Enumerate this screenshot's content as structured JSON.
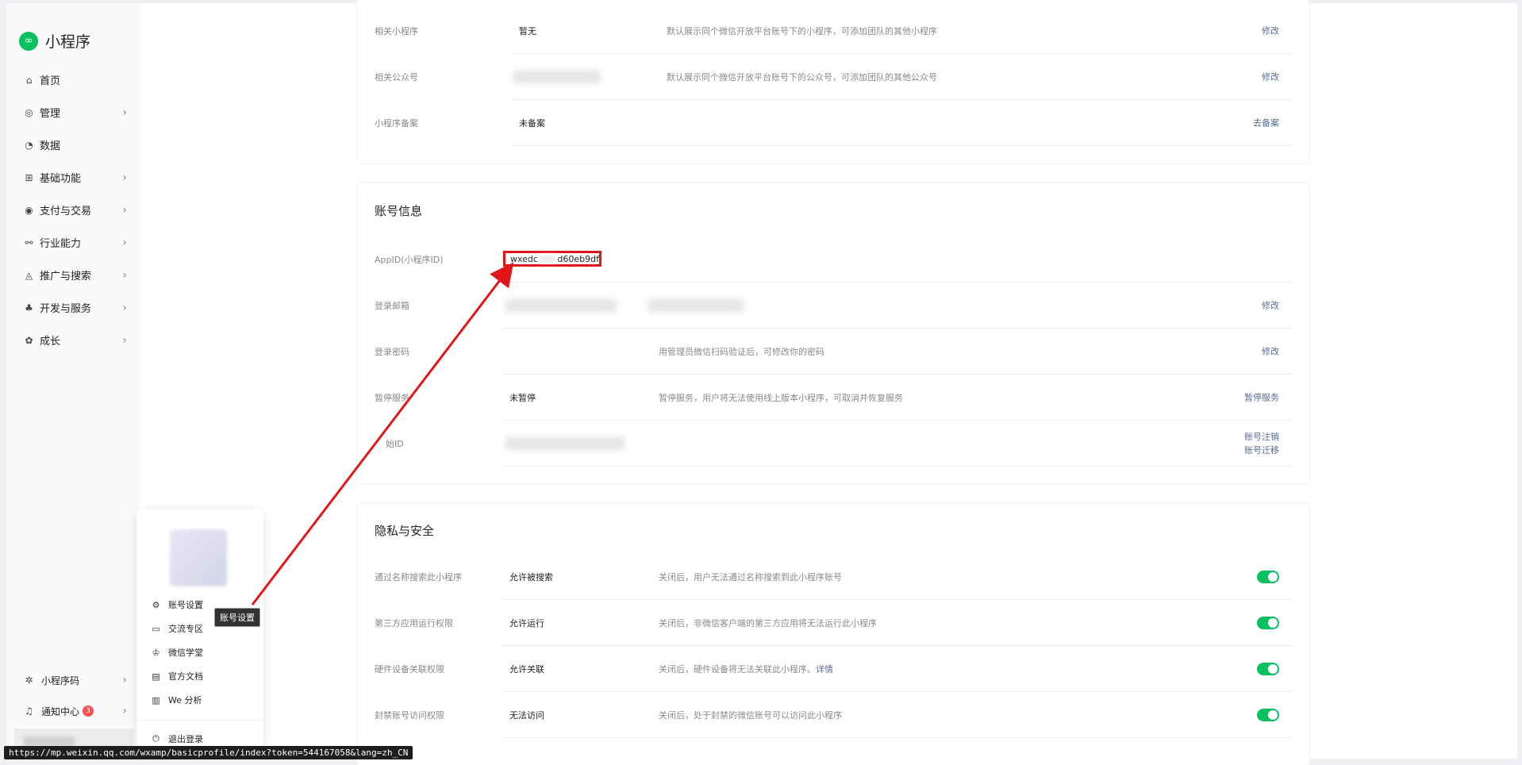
{
  "app": {
    "name": "小程序",
    "logo_icon": "miniprogram-logo-icon",
    "accent": "#07c160"
  },
  "sidebar": {
    "items": [
      {
        "label": "首页",
        "icon": "home-icon",
        "chev": false
      },
      {
        "label": "管理",
        "icon": "settings-icon",
        "chev": true
      },
      {
        "label": "数据",
        "icon": "clock-icon",
        "chev": false
      },
      {
        "label": "基础功能",
        "icon": "grid-icon",
        "chev": true
      },
      {
        "label": "支付与交易",
        "icon": "target-icon",
        "chev": true
      },
      {
        "label": "行业能力",
        "icon": "network-icon",
        "chev": true
      },
      {
        "label": "推广与搜索",
        "icon": "flame-icon",
        "chev": true
      },
      {
        "label": "开发与服务",
        "icon": "cluster-icon",
        "chev": true
      },
      {
        "label": "成长",
        "icon": "badge-icon",
        "chev": true
      }
    ],
    "bottom": {
      "qrcode": "小程序码",
      "notice": "通知中心",
      "notice_count": "3"
    }
  },
  "popup": {
    "items": [
      "账号设置",
      "交流专区",
      "微信学堂",
      "官方文档",
      "We 分析"
    ],
    "logout": "退出登录"
  },
  "tooltip": "账号设置",
  "status_url": "https://mp.weixin.qq.com/wxamp/basicprofile/index?token=544167058&lang=zh_CN",
  "section1": {
    "rows": [
      {
        "label": "相关小程序",
        "value": "暂无",
        "desc": "默认展示同个微信开放平台账号下的小程序，可添加团队的其他小程序",
        "action": "修改"
      },
      {
        "label": "相关公众号",
        "value": "",
        "desc": "默认展示同个微信开放平台账号下的公众号，可添加团队的其他公众号",
        "action": "修改"
      },
      {
        "label": "小程序备案",
        "value": "未备案",
        "desc": "",
        "action": "去备案"
      }
    ]
  },
  "account": {
    "title": "账号信息",
    "appid_label": "AppID(小程序ID)",
    "appid_prefix": "wxedc",
    "appid_suffix": "d60eb9df",
    "email_label": "登录邮箱",
    "email_action": "修改",
    "password_label": "登录密码",
    "password_desc": "用管理员微信扫码验证后，可修改你的密码",
    "password_action": "修改",
    "pause_label": "暂停服务",
    "pause_value": "未暂停",
    "pause_desc": "暂停服务，用户将无法使用线上版本小程序，可取消并恢复服务",
    "pause_action": "暂停服务",
    "origin_label": "始ID",
    "cancel_action": "账号注销",
    "migrate_action": "账号迁移"
  },
  "privacy": {
    "title": "隐私与安全",
    "rows": [
      {
        "label": "通过名称搜索此小程序",
        "value": "允许被搜索",
        "desc": "关闭后，用户无法通过名称搜索到此小程序账号",
        "enabled": true
      },
      {
        "label": "第三方应用运行权限",
        "value": "允许运行",
        "desc": "关闭后，非微信客户端的第三方应用将无法运行此小程序",
        "enabled": true
      },
      {
        "label": "硬件设备关联权限",
        "value": "允许关联",
        "desc": "关闭后，硬件设备将无法关联此小程序。",
        "desc_link": "详情",
        "enabled": true
      },
      {
        "label": "封禁账号访问权限",
        "value": "无法访问",
        "desc": "关闭后，处于封禁的微信账号可以访问此小程序",
        "enabled": true
      }
    ]
  },
  "highlight_color": "#e0161b"
}
